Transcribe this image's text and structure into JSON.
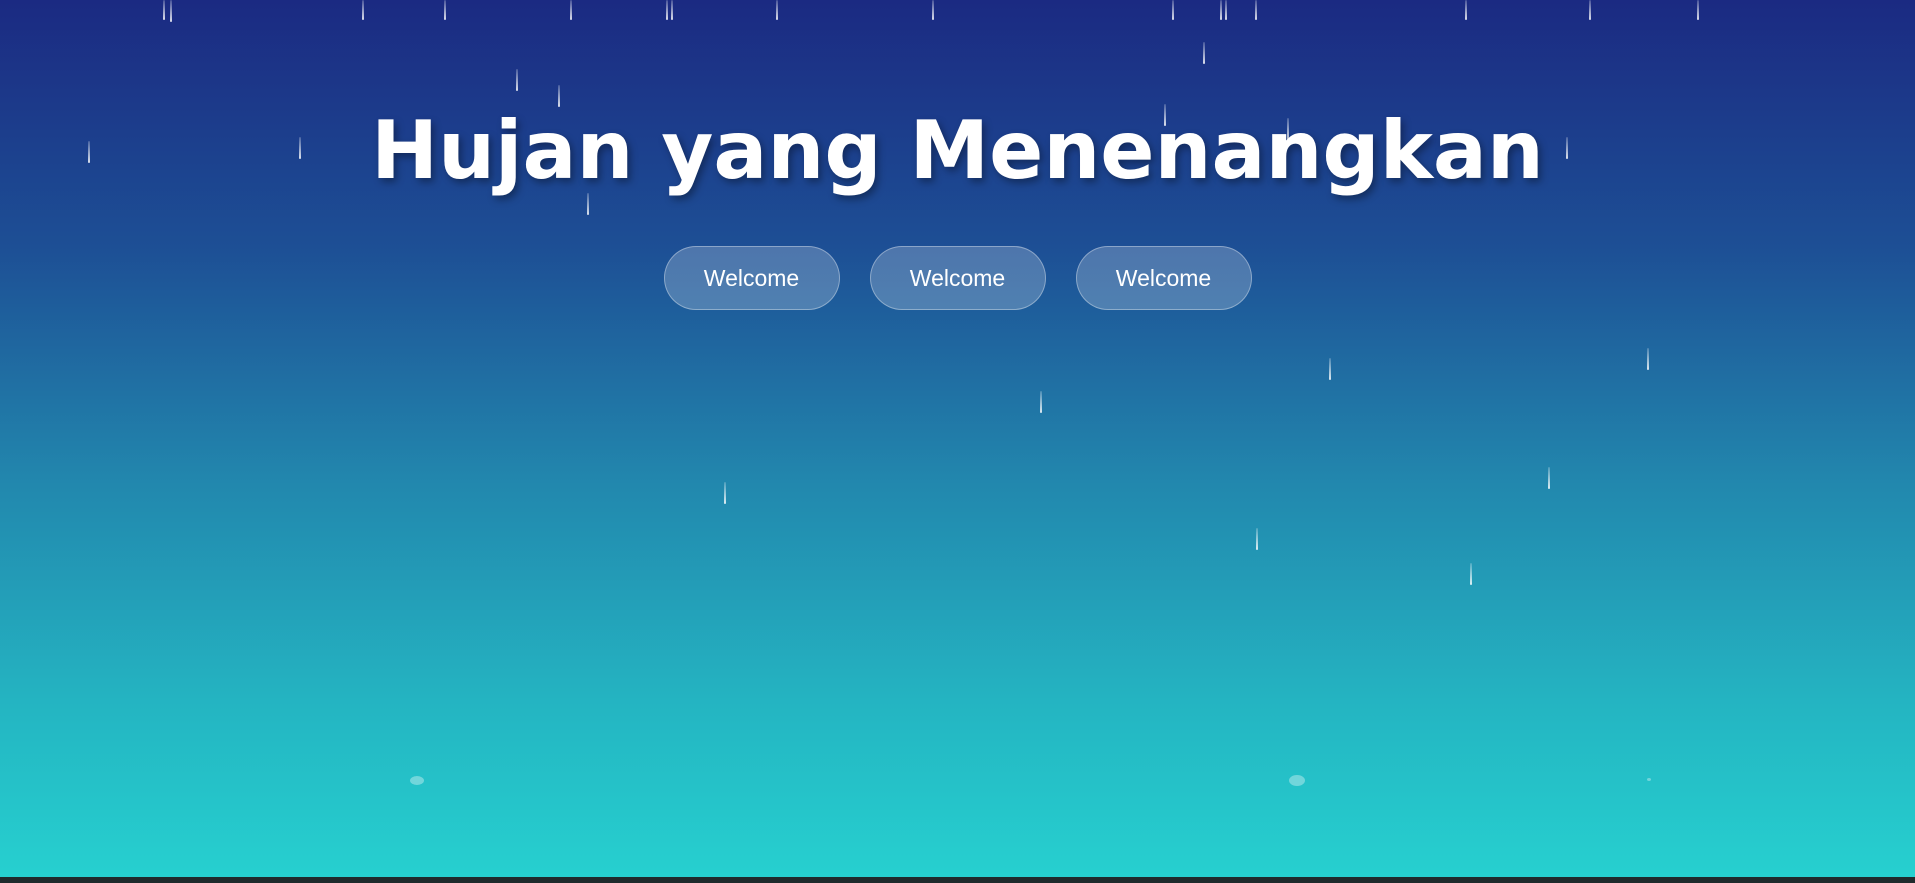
{
  "page": {
    "title": "Hujan yang Menenangkan"
  },
  "buttons": [
    {
      "label": "Welcome"
    },
    {
      "label": "Welcome"
    },
    {
      "label": "Welcome"
    }
  ],
  "colors": {
    "background_top": "#1b2a82",
    "background_bottom": "#26d1d0",
    "title_text": "#ffffff",
    "raindrop": "#ffffff"
  }
}
